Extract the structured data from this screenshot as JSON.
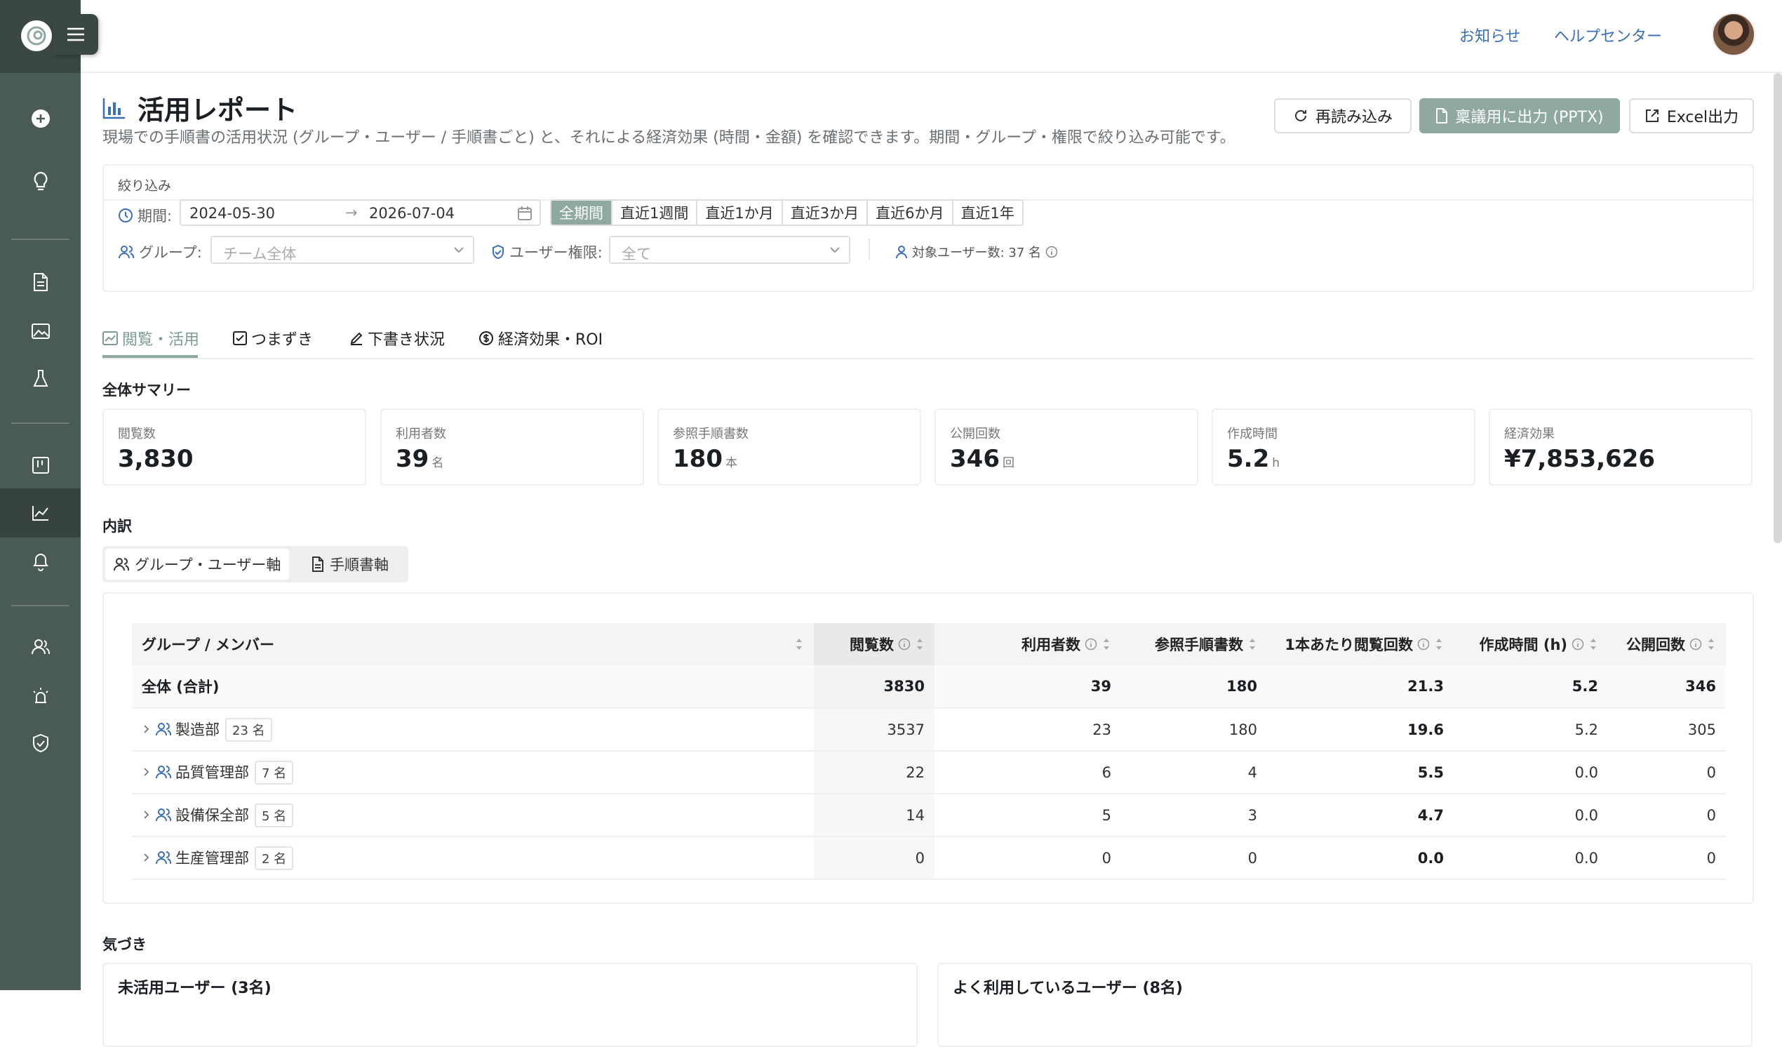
{
  "topbar": {
    "news": "お知らせ",
    "help": "ヘルプセンター"
  },
  "page": {
    "title": "活用レポート",
    "subtitle": "現場での手順書の活用状況 (グループ・ユーザー / 手順書ごと) と、それによる経済効果 (時間・金額) を確認できます。期間・グループ・権限で絞り込み可能です。"
  },
  "actions": {
    "reload": "再読み込み",
    "pptx": "稟議用に出力 (PPTX)",
    "excel": "Excel出力"
  },
  "filter": {
    "heading": "絞り込み",
    "period_label": "期間:",
    "start_date": "2024-05-30",
    "end_date": "2026-07-04",
    "quick_ranges": [
      "全期間",
      "直近1週間",
      "直近1か月",
      "直近3か月",
      "直近6か月",
      "直近1年"
    ],
    "group_label": "グループ:",
    "group_placeholder": "チーム全体",
    "role_label": "ユーザー権限:",
    "role_placeholder": "全て",
    "target_users": "対象ユーザー数: 37 名"
  },
  "tabs": [
    "閲覧・活用",
    "つまずき",
    "下書き状況",
    "経済効果・ROI"
  ],
  "summary": {
    "heading": "全体サマリー",
    "cards": [
      {
        "label": "閲覧数",
        "value": "3,830",
        "unit": ""
      },
      {
        "label": "利用者数",
        "value": "39",
        "unit": "名"
      },
      {
        "label": "参照手順書数",
        "value": "180",
        "unit": "本"
      },
      {
        "label": "公開回数",
        "value": "346",
        "unit": "回"
      },
      {
        "label": "作成時間",
        "value": "5.2",
        "unit": "h"
      },
      {
        "label": "経済効果",
        "value": "¥7,853,626",
        "unit": ""
      }
    ]
  },
  "breakdown": {
    "heading": "内訳",
    "segments": [
      "グループ・ユーザー軸",
      "手順書軸"
    ],
    "columns": [
      "グループ / メンバー",
      "閲覧数",
      "利用者数",
      "参照手順書数",
      "1本あたり閲覧回数",
      "作成時間 (h)",
      "公開回数"
    ],
    "total": {
      "name": "全体 (合計)",
      "views": "3830",
      "users": "39",
      "docs": "180",
      "per_doc": "21.3",
      "hours": "5.2",
      "publishes": "346"
    },
    "rows": [
      {
        "name": "製造部",
        "count": "23 名",
        "views": "3537",
        "users": "23",
        "docs": "180",
        "per_doc": "19.6",
        "hours": "5.2",
        "publishes": "305"
      },
      {
        "name": "品質管理部",
        "count": "7 名",
        "views": "22",
        "users": "6",
        "docs": "4",
        "per_doc": "5.5",
        "hours": "0.0",
        "publishes": "0"
      },
      {
        "name": "設備保全部",
        "count": "5 名",
        "views": "14",
        "users": "5",
        "docs": "3",
        "per_doc": "4.7",
        "hours": "0.0",
        "publishes": "0"
      },
      {
        "name": "生産管理部",
        "count": "2 名",
        "views": "0",
        "users": "0",
        "docs": "0",
        "per_doc": "0.0",
        "hours": "0.0",
        "publishes": "0"
      }
    ]
  },
  "insights": {
    "heading": "気づき",
    "inactive_users": "未活用ユーザー (3名)",
    "active_users": "よく利用しているユーザー (8名)"
  }
}
